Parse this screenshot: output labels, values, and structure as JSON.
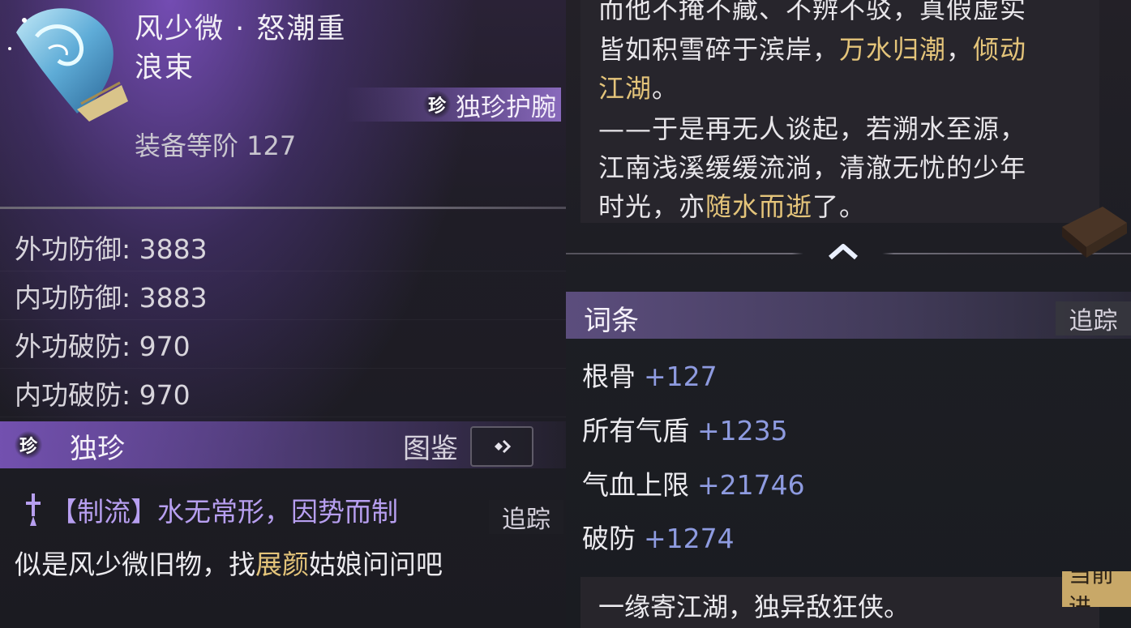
{
  "item": {
    "name_line1": "风少微 · 怒潮重",
    "name_line2": "浪束",
    "rarity_badge": "珍",
    "rarity_type": "独珍护腕",
    "level": "装备等阶 127",
    "icon": "water-wave-bracer-icon"
  },
  "stats": [
    {
      "label": "外功防御: 3883"
    },
    {
      "label": "内功防御: 3883"
    },
    {
      "label": "外功破防: 970"
    },
    {
      "label": "内功破防: 970"
    }
  ],
  "unique_section": {
    "badge": "珍",
    "label": "独珍",
    "codex_label": "图鉴",
    "codex_icon": "diamond-arrow-icon"
  },
  "flavor": {
    "line1": "【制流】水无常形，因势而制",
    "line2_pre": "似是风少微旧物，找",
    "line2_highlight": "展颜",
    "line2_post": "姑娘问问吧"
  },
  "track_label": "追踪",
  "lore": {
    "line0": "而他不掩不藏、不辨不驳，真假虚实",
    "line1_pre": "皆如积雪碎于滨岸，",
    "line1_hl1": "万水归潮",
    "line1_mid": "，",
    "line1_hl2": "倾动",
    "line2_hl": "江湖",
    "line2_post": "。",
    "line3": "——于是再无人谈起，若溯水至源，",
    "line4": "江南浅溪缓缓流淌，清澈无忧的少年",
    "line5_pre": "时光，亦",
    "line5_hl": "随水而逝",
    "line5_post": "了。"
  },
  "affix": {
    "title": "词条",
    "rows": [
      {
        "name": "根骨",
        "value": "+127"
      },
      {
        "name": "所有气盾",
        "value": "+1235"
      },
      {
        "name": "气血上限",
        "value": "+21746"
      },
      {
        "name": "破防",
        "value": "+1274"
      }
    ]
  },
  "bottom_text": "一缘寄江湖，独异敌狂侠。",
  "current_label": "当前进",
  "colors": {
    "highlight": "#e4c47a",
    "affix_value": "#8e9be0",
    "flavor_purple": "#b79ff0",
    "accent_purple": "#8a5ed0"
  }
}
